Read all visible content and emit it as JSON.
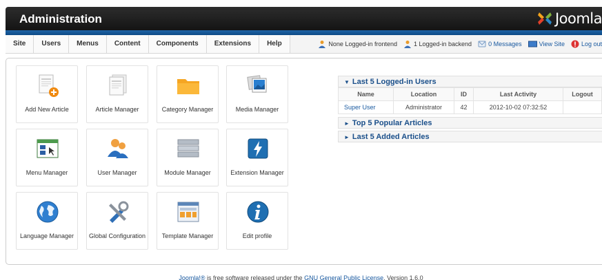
{
  "header": {
    "title": "Administration",
    "brand": "Joomla"
  },
  "menu": [
    "Site",
    "Users",
    "Menus",
    "Content",
    "Components",
    "Extensions",
    "Help"
  ],
  "status": {
    "frontend": "None Logged-in frontend",
    "backend": "1 Logged-in backend",
    "messages": "0 Messages",
    "view_site": "View Site",
    "logout": "Log out"
  },
  "quick_icons": [
    {
      "label": "Add New Article",
      "icon": "add-article-icon"
    },
    {
      "label": "Article Manager",
      "icon": "article-manager-icon"
    },
    {
      "label": "Category Manager",
      "icon": "folder-icon"
    },
    {
      "label": "Media Manager",
      "icon": "media-icon"
    },
    {
      "label": "Menu Manager",
      "icon": "menu-manager-icon"
    },
    {
      "label": "User Manager",
      "icon": "users-icon"
    },
    {
      "label": "Module Manager",
      "icon": "module-icon"
    },
    {
      "label": "Extension Manager",
      "icon": "extension-icon"
    },
    {
      "label": "Language Manager",
      "icon": "globe-icon"
    },
    {
      "label": "Global Configuration",
      "icon": "tools-icon"
    },
    {
      "label": "Template Manager",
      "icon": "template-icon"
    },
    {
      "label": "Edit profile",
      "icon": "info-icon"
    }
  ],
  "modules": {
    "logged_in": {
      "title": "Last 5 Logged-in Users",
      "columns": [
        "Name",
        "Location",
        "ID",
        "Last Activity",
        "Logout"
      ],
      "rows": [
        {
          "name": "Super User",
          "location": "Administrator",
          "id": "42",
          "last_activity": "2012-10-02 07:32:52",
          "logout": ""
        }
      ]
    },
    "popular": {
      "title": "Top 5 Popular Articles"
    },
    "added": {
      "title": "Last 5 Added Articles"
    }
  },
  "footer": {
    "joomla": "Joomla!®",
    "text": " is free software released under the ",
    "license": "GNU General Public License",
    "version": ".    Version 1.6.0"
  },
  "colors": {
    "header_bg": "#1b1b1b",
    "accent_blue": "#1762a7",
    "link": "#1a5aa0",
    "brand_icon": [
      "#f4a31c",
      "#80b03c",
      "#e3402a",
      "#2a86c8"
    ]
  }
}
